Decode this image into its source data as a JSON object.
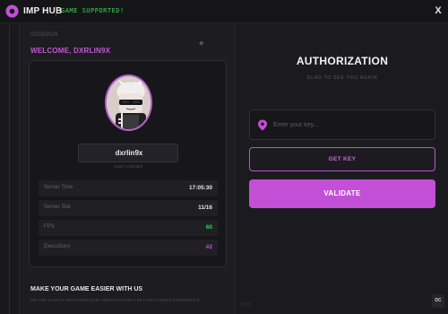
{
  "app": {
    "title": "IMP HUB",
    "game_status": "GAME SUPPORTED!",
    "close_label": "X",
    "accent": "#c44fd7",
    "status_color": "#3fd15a"
  },
  "left_panel": {
    "date": "02/03/2024",
    "welcome": "WELCOME, DXRLIN9X",
    "profile": {
      "username": "dxrlin9x",
      "username_caption": "Super Unlimited"
    },
    "stats": [
      {
        "label": "Server Time",
        "value": "17:05:30",
        "color": "#e8e8e8"
      },
      {
        "label": "Server Slot",
        "value": "11/16",
        "color": "#e8e8e8"
      },
      {
        "label": "FPS",
        "value": "60",
        "color": "#3fd15a"
      },
      {
        "label": "Executions",
        "value": "#2",
        "color": "#c257d6"
      }
    ],
    "promo": {
      "title": "MAKE YOUR GAME EASIER WITH US",
      "subtitle": "WE ARE ALWAYS IMPROVING OUR SERVICES FOR A BETTER GAMING EXPERIENCE"
    }
  },
  "auth": {
    "title": "AUTHORIZATION",
    "subtitle": "GLAD TO SEE YOU AGAIN",
    "key_input": {
      "placeholder": "Enter your key...",
      "value": ""
    },
    "get_key_label": "GET KEY",
    "validate_label": "VALIDATE"
  },
  "footer": {
    "left_text": "1.0.0",
    "dc_label": "DC"
  },
  "icons": {
    "logo": "location-pin-icon",
    "key": "location-pin-icon",
    "close": "close-icon"
  }
}
